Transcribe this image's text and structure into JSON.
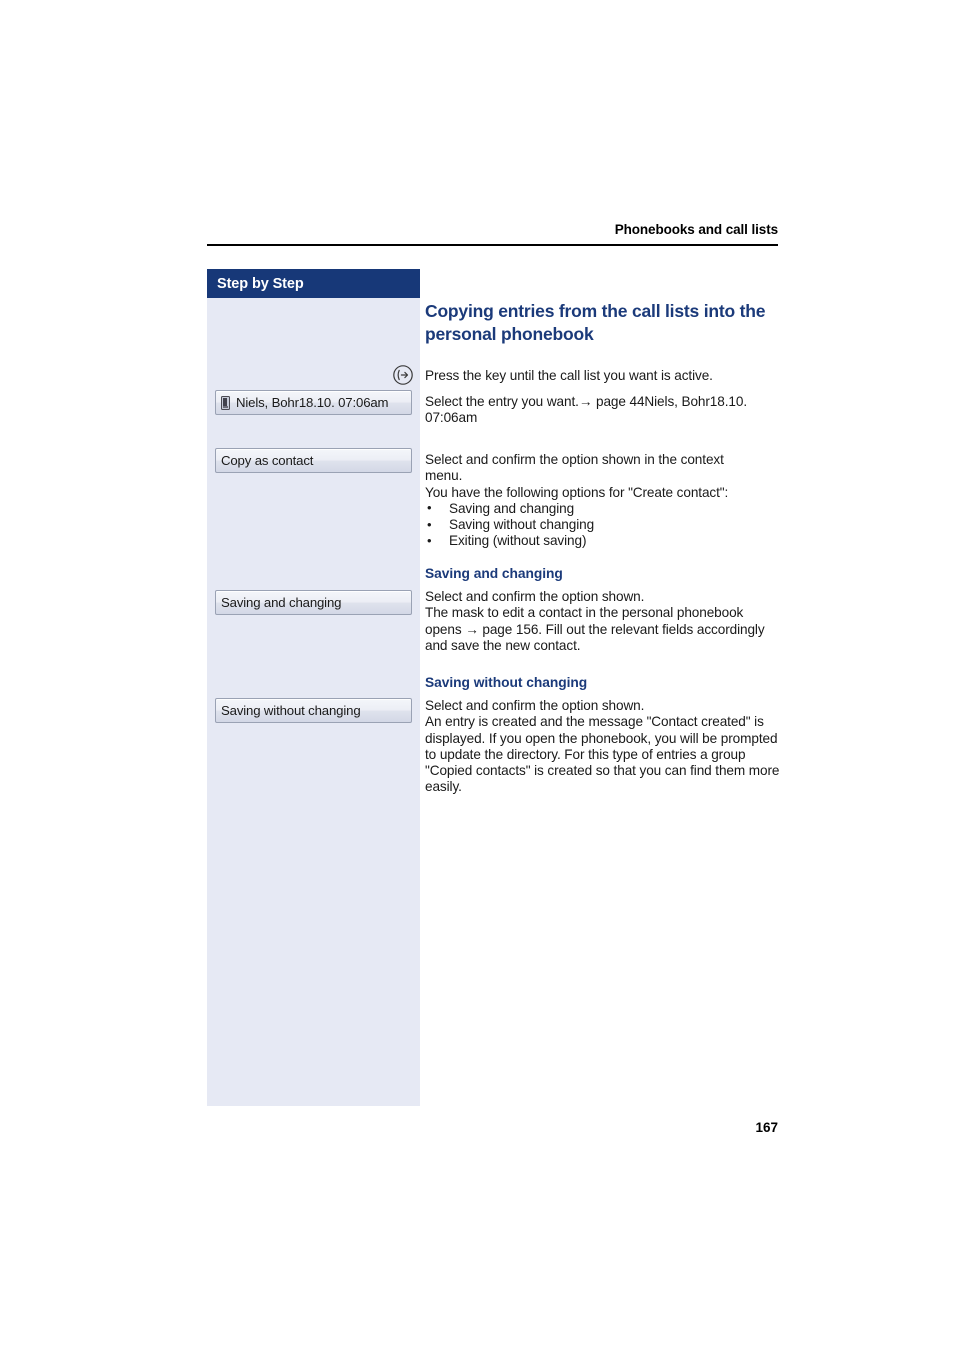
{
  "header": {
    "running_title": "Phonebooks and call lists"
  },
  "sidebar": {
    "title": "Step by Step",
    "buttons": [
      {
        "label": "Niels, Bohr18.10. 07:06am",
        "icon": "handset-icon"
      },
      {
        "label": "Copy as contact"
      },
      {
        "label": "Saving and changing"
      },
      {
        "label": "Saving without changing"
      }
    ]
  },
  "icons": {
    "call_list_key": "call-list-key-icon"
  },
  "main": {
    "heading": "Copying entries from the call lists into the personal phonebook",
    "intro_paragraph": "Press the key until the call list you want is active.",
    "select_entry_paragraph": "Select the entry you want.→ page 44Niels, Bohr18.10. 07:06am",
    "context_paragraph_line1": "Select and confirm the option shown in the context",
    "context_paragraph_line2": "menu.",
    "context_paragraph_line3": "You have the following options for \"Create contact\":",
    "options": [
      "Saving and changing",
      "Saving without changing",
      "Exiting (without saving)"
    ],
    "section_saving_and_changing": {
      "heading": "Saving and changing",
      "body": "Select and confirm the option shown.\nThe mask to edit a contact in the personal phonebook opens → page 156. Fill out the relevant fields accordingly and save the new contact."
    },
    "section_saving_without_changing": {
      "heading": "Saving without changing",
      "body": "Select and confirm the option shown.\nAn entry is created and the message \"Contact created\" is displayed. If you open the phonebook, you will be prompted to update the directory. For this type of entries a group \"Copied contacts\" is created so that you can find them more easily."
    }
  },
  "footer": {
    "page_number": "167"
  },
  "colors": {
    "accent_navy": "#173878",
    "heading_blue": "#1b3a7a",
    "sidebar_bg": "#e6e9f4"
  }
}
